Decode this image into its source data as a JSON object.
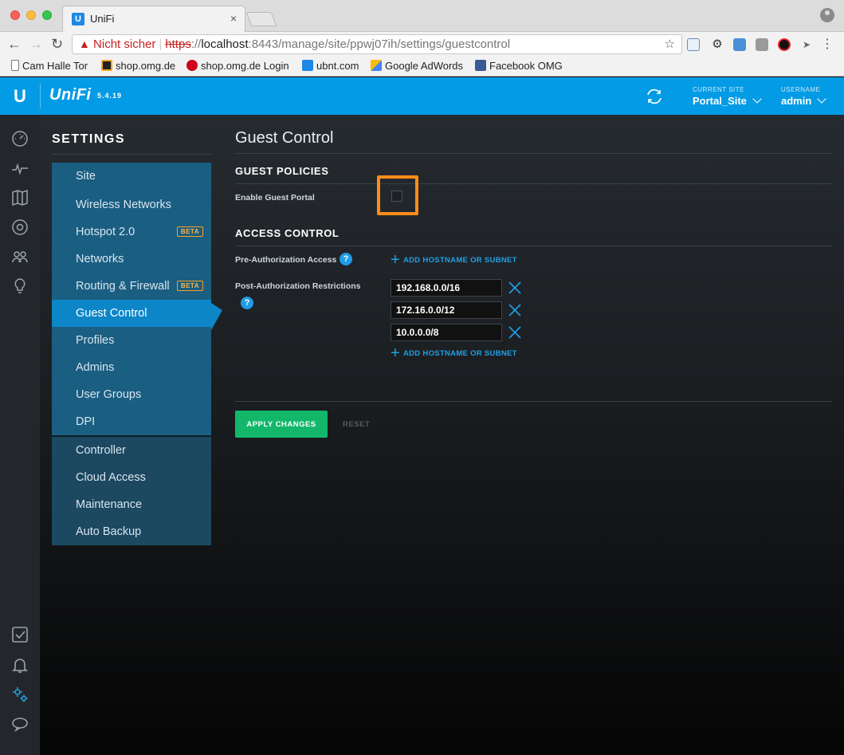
{
  "browser": {
    "tab_title": "UniFi",
    "tab_close": "×",
    "not_secure": "Nicht sicher",
    "url_scheme": "https",
    "url_sep": "://",
    "url_host": "localhost",
    "url_path": ":8443/manage/site/ppwj07ih/settings/guestcontrol",
    "bookmarks": [
      {
        "label": "Cam Halle Tor"
      },
      {
        "label": "shop.omg.de"
      },
      {
        "label": "shop.omg.de Login"
      },
      {
        "label": "ubnt.com"
      },
      {
        "label": "Google AdWords"
      },
      {
        "label": "Facebook OMG"
      }
    ]
  },
  "header": {
    "logo": "U",
    "brand": "UniFi",
    "version": "5.4.19",
    "current_site_label": "CURRENT SITE",
    "current_site": "Portal_Site",
    "username_label": "USERNAME",
    "username": "admin",
    "accent_color": "#039be5"
  },
  "rail": {
    "icons": [
      "dashboard-icon",
      "statistics-icon",
      "map-icon",
      "devices-icon",
      "clients-icon",
      "insights-icon",
      "events-icon",
      "alerts-icon",
      "settings-icon",
      "chat-icon"
    ]
  },
  "settings": {
    "title": "SETTINGS",
    "menu": [
      {
        "label": "Site"
      },
      {
        "label": "Wireless Networks"
      },
      {
        "label": "Hotspot 2.0",
        "badge": "BETA"
      },
      {
        "label": "Networks"
      },
      {
        "label": "Routing & Firewall",
        "badge": "BETA"
      },
      {
        "label": "Guest Control",
        "active": true
      },
      {
        "label": "Profiles"
      },
      {
        "label": "Admins"
      },
      {
        "label": "User Groups"
      },
      {
        "label": "DPI"
      }
    ],
    "menu_group_2": [
      {
        "label": "Controller"
      },
      {
        "label": "Cloud Access"
      },
      {
        "label": "Maintenance"
      },
      {
        "label": "Auto Backup"
      }
    ]
  },
  "page": {
    "title": "Guest Control",
    "guest_policies_title": "GUEST POLICIES",
    "enable_guest_portal_label": "Enable Guest Portal",
    "enable_guest_portal_checked": false,
    "access_control_title": "ACCESS CONTROL",
    "pre_auth_label": "Pre-Authorization Access",
    "post_auth_label": "Post-Authorization Restrictions",
    "help_glyph": "?",
    "add_plus": "+",
    "add_hostname_label": "ADD HOSTNAME OR SUBNET",
    "post_auth_restrictions": [
      "192.168.0.0/16",
      "172.16.0.0/12",
      "10.0.0.0/8"
    ],
    "apply_label": "APPLY CHANGES",
    "reset_label": "RESET",
    "apply_color": "#12b76a",
    "highlight_color": "#ff8c1a"
  }
}
